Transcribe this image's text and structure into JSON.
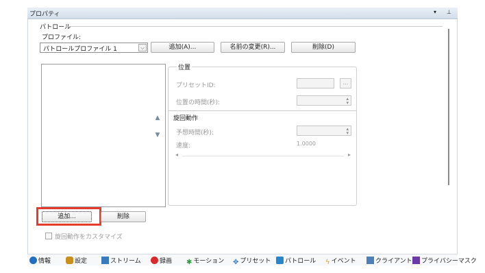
{
  "window": {
    "title": "プロパティ",
    "pin_glyph": "▾ ⊥"
  },
  "patrol": {
    "section_label": "パトロール",
    "profile_label": "プロファイル:",
    "profile_value": "パトロールプロファイル 1",
    "add_profile": "追加(A)...",
    "rename_profile": "名前の変更(R)...",
    "delete_profile": "削除(D)",
    "position_group": "位置",
    "preset_id_label": "プリセットID:",
    "preset_browse": "...",
    "position_time_label": "位置の時間(秒):",
    "rotation_group": "旋回動作",
    "expected_time_label": "予想時間(秒):",
    "speed_label": "速度:",
    "speed_value": "1.0000",
    "add_button": "追加...",
    "remove_button": "削除",
    "customize_rotation": "旋回動作をカスタマイズ"
  },
  "tabs": [
    {
      "label": "情報",
      "icon": "info-icon",
      "color": "#1f6fc4"
    },
    {
      "label": "設定",
      "icon": "settings-icon",
      "color": "#c8901f"
    },
    {
      "label": "ストリーム",
      "icon": "stream-icon",
      "color": "#3a7bbf"
    },
    {
      "label": "録画",
      "icon": "record-icon",
      "color": "#d9292c"
    },
    {
      "label": "モーション",
      "icon": "motion-icon",
      "color": "#2e9a3b"
    },
    {
      "label": "プリセット",
      "icon": "preset-icon",
      "color": "#3a7bbf"
    },
    {
      "label": "パトロール",
      "icon": "patrol-icon",
      "color": "#2a86c9"
    },
    {
      "label": "イベント",
      "icon": "event-icon",
      "color": "#d8a11e"
    },
    {
      "label": "クライアント",
      "icon": "client-icon",
      "color": "#4e7fb5"
    },
    {
      "label": "プライバシーマスク",
      "icon": "privacy-mask-icon",
      "color": "#6a3aa8"
    }
  ],
  "colors": {
    "highlight": "#e53a2f"
  }
}
